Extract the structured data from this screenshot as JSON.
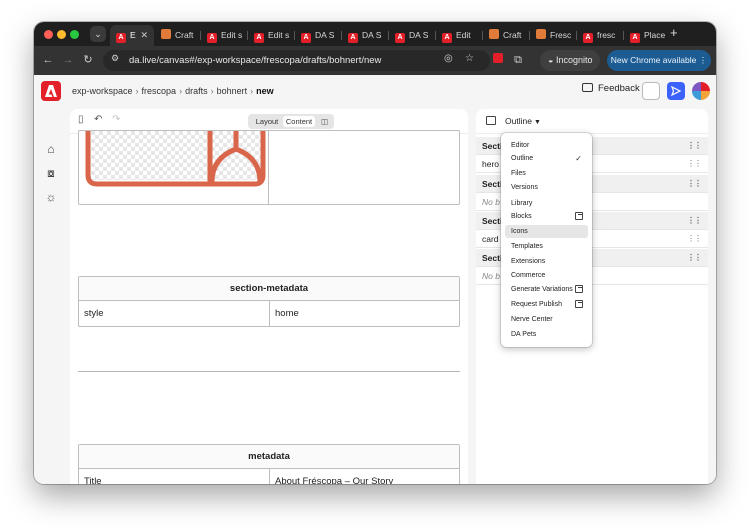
{
  "browser": {
    "tabs": [
      {
        "label": "E",
        "favicon": "adobe",
        "active": true
      },
      {
        "label": "Craft",
        "favicon": "craft"
      },
      {
        "label": "Edit s",
        "favicon": "adobe"
      },
      {
        "label": "Edit s",
        "favicon": "adobe"
      },
      {
        "label": "DA S",
        "favicon": "adobe"
      },
      {
        "label": "DA S",
        "favicon": "adobe"
      },
      {
        "label": "DA S",
        "favicon": "adobe"
      },
      {
        "label": "Edit",
        "favicon": "adobe"
      },
      {
        "label": "Craft",
        "favicon": "craft"
      },
      {
        "label": "Fresc",
        "favicon": "craft"
      },
      {
        "label": "fresc",
        "favicon": "adobe"
      },
      {
        "label": "Place",
        "favicon": "adobe"
      }
    ],
    "url": "da.live/canvas#/exp-workspace/frescopa/drafts/bohnert/new",
    "incognito_label": "Incognito",
    "update_label": "New Chrome available"
  },
  "header": {
    "breadcrumbs": [
      "exp-workspace",
      "frescopa",
      "drafts",
      "bohnert"
    ],
    "current": "new",
    "feedback_label": "Feedback"
  },
  "editor": {
    "view_toggle": {
      "layout_label": "Layout",
      "content_label": "Content",
      "selected": "Content"
    },
    "section_metadata": {
      "title": "section-metadata",
      "rows": [
        {
          "key": "style",
          "value": "home"
        }
      ]
    },
    "metadata": {
      "title": "metadata",
      "rows": [
        {
          "key": "Title",
          "value": "About Fréscopa – Our Story"
        }
      ]
    }
  },
  "outline_panel": {
    "selected_view": "Outline",
    "rows": [
      {
        "label": "Sectio",
        "kind": "section"
      },
      {
        "label": "hero",
        "kind": "block"
      },
      {
        "label": "Sectio",
        "kind": "section"
      },
      {
        "label": "No b",
        "kind": "empty"
      },
      {
        "label": "Sectio",
        "kind": "section"
      },
      {
        "label": "card",
        "kind": "block"
      },
      {
        "label": "Sectio",
        "kind": "section"
      },
      {
        "label": "No b",
        "kind": "empty"
      }
    ]
  },
  "view_menu": {
    "items": [
      {
        "label": "Editor"
      },
      {
        "label": "Outline",
        "checked": true
      },
      {
        "label": "Files"
      },
      {
        "label": "Versions"
      },
      {
        "label": "Library"
      },
      {
        "label": "Blocks",
        "external": true
      },
      {
        "label": "Icons",
        "hover": true
      },
      {
        "label": "Templates"
      },
      {
        "label": "Extensions"
      },
      {
        "label": "Commerce"
      },
      {
        "label": "Generate Variations",
        "external": true
      },
      {
        "label": "Request Publish",
        "external": true
      },
      {
        "label": "Nerve Center"
      },
      {
        "label": "DA Pets"
      }
    ]
  },
  "colors": {
    "brand": "#e3202a",
    "accent": "#3b63fb",
    "image_frame": "#d9664a",
    "chrome_dark": "#1f1f1f",
    "update_button": "#1c5c93"
  }
}
